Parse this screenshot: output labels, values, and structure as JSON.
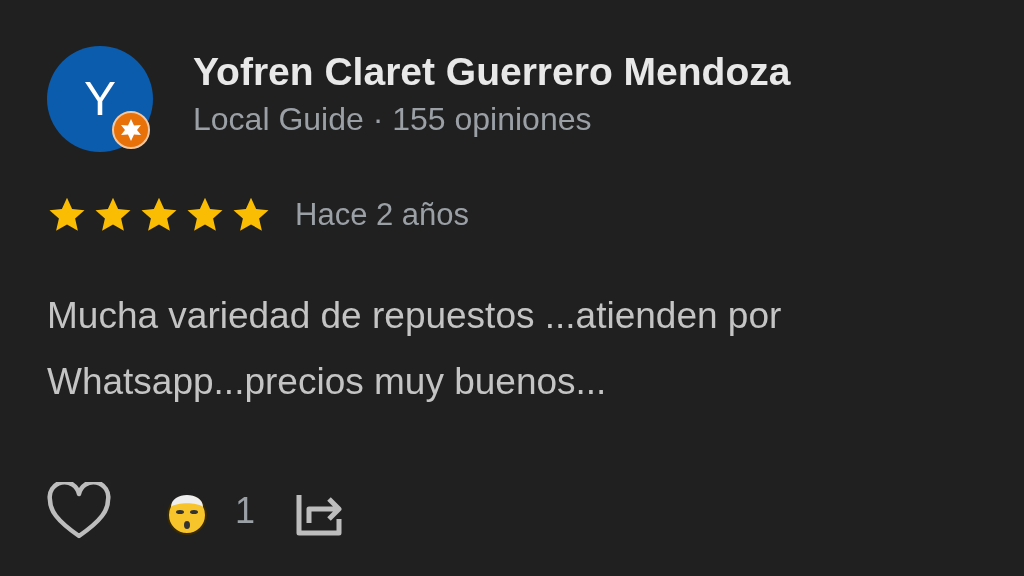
{
  "review": {
    "avatar": {
      "initial": "Y"
    },
    "author": "Yofren Claret Guerrero Mendoza",
    "meta": "Local Guide · 155 opiniones",
    "stars": 5,
    "time": "Hace 2 años",
    "text": "Mucha variedad de repuestos ...atienden por Whatsapp...precios muy buenos...",
    "reaction_count": "1"
  }
}
